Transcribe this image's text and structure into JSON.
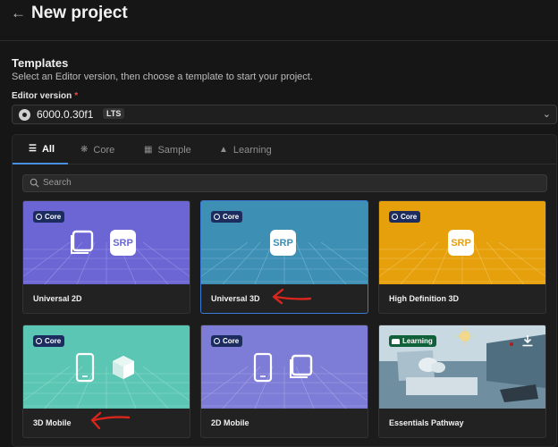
{
  "header": {
    "title": "New project",
    "back_icon": "arrow-left-icon"
  },
  "templates_section": {
    "title": "Templates",
    "subtitle": "Select an Editor version, then choose a template to start your project.",
    "editor_version": {
      "label": "Editor version",
      "required_mark": "*",
      "value": "6000.0.30f1",
      "badge": "LTS"
    }
  },
  "tabs": [
    {
      "label": "All",
      "icon": "list-icon",
      "active": true
    },
    {
      "label": "Core",
      "icon": "core-icon"
    },
    {
      "label": "Sample",
      "icon": "sample-icon"
    },
    {
      "label": "Learning",
      "icon": "learning-icon"
    }
  ],
  "search": {
    "placeholder": "Search"
  },
  "cards": [
    {
      "label": "Universal 2D",
      "badge": "Core",
      "thumb_color": "#6b66d4",
      "icons": [
        "square-icon",
        "srp-icon"
      ]
    },
    {
      "label": "Universal 3D",
      "badge": "Core",
      "thumb_color": "#3e8fb4",
      "icons": [
        "srp-icon"
      ],
      "selected": true
    },
    {
      "label": "High Definition 3D",
      "badge": "Core",
      "thumb_color": "#e6a00c",
      "icons": [
        "srp-icon"
      ]
    },
    {
      "label": "3D Mobile",
      "badge": "Core",
      "thumb_color": "#5cc6b4",
      "icons": [
        "phone-icon",
        "cube-icon"
      ]
    },
    {
      "label": "2D Mobile",
      "badge": "Core",
      "thumb_color": "#7d7cd6",
      "icons": [
        "phone-icon",
        "square-icon"
      ]
    },
    {
      "label": "Essentials Pathway",
      "badge": "Learning",
      "thumb_color": "#7f9cae",
      "icons": [
        "download-icon"
      ]
    }
  ],
  "srp_text": "SRP",
  "colors": {
    "accent": "#3b7ad6",
    "badge_core": "#1c2c5e",
    "badge_learning": "#10603a",
    "annotation": "#d9261c"
  }
}
